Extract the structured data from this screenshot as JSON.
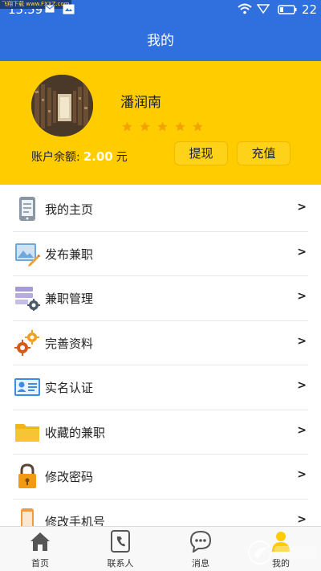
{
  "status_bar": {
    "time": "15:59",
    "battery_level": "22",
    "watermark": "飞翔下载 www.FXXZ.com"
  },
  "header": {
    "title": "我的"
  },
  "profile": {
    "username": "潘润南",
    "rating_stars": 5,
    "balance_label": "账户余额:",
    "balance_amount": "2.00",
    "balance_unit": "元",
    "withdraw_label": "提现",
    "recharge_label": "充值"
  },
  "menu": {
    "items": [
      {
        "label": "我的主页",
        "icon": "tablet-icon"
      },
      {
        "label": "发布兼职",
        "icon": "image-edit-icon"
      },
      {
        "label": "兼职管理",
        "icon": "list-settings-icon"
      },
      {
        "label": "完善资料",
        "icon": "gears-icon"
      },
      {
        "label": "实名认证",
        "icon": "id-card-icon"
      },
      {
        "label": "收藏的兼职",
        "icon": "folder-icon"
      },
      {
        "label": "修改密码",
        "icon": "lock-icon"
      },
      {
        "label": "修改手机号",
        "icon": "phone-icon"
      }
    ],
    "arrow": ">"
  },
  "tabs": {
    "home": "首页",
    "contacts": "联系人",
    "messages": "消息",
    "mine": "我的"
  },
  "colors": {
    "primary": "#2f6fde",
    "profile_bg": "#ffcc00",
    "star": "#f2a300"
  }
}
